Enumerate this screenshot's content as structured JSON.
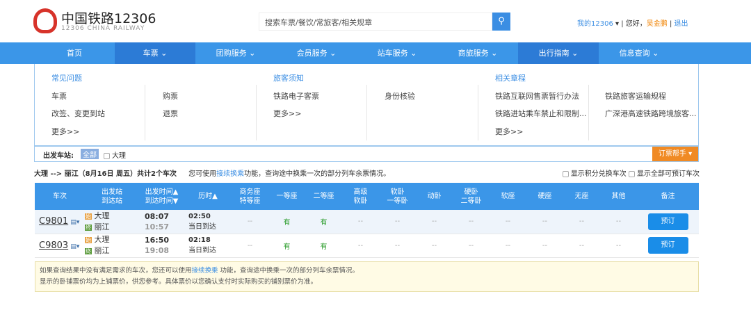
{
  "header": {
    "logo_cn": "中国铁路12306",
    "logo_en": "12306 CHINA RAILWAY",
    "search_placeholder": "搜索车票/餐饮/常旅客/相关规章",
    "my12306": "我的12306",
    "greeting": "您好，",
    "user": "吴金鹏",
    "logout": "退出"
  },
  "nav": [
    "首页",
    "车票",
    "团购服务",
    "会员服务",
    "站车服务",
    "商旅服务",
    "出行指南",
    "信息查询"
  ],
  "panel": {
    "col1": {
      "title": "常见问题",
      "items": [
        "车票",
        "购票",
        "改签、变更到站",
        "退票",
        "更多>>"
      ]
    },
    "col2": {
      "title": "旅客须知",
      "items": [
        "铁路电子客票",
        "身份核验",
        "更多>>"
      ]
    },
    "col3": {
      "title": "相关章程",
      "items": [
        "铁路互联网售票暂行办法",
        "铁路旅客运输规程",
        "铁路进站乘车禁止和限制...",
        "广深港高速铁路跨境旅客...",
        "更多>>"
      ]
    }
  },
  "filter": {
    "label": "出发车站:",
    "all": "全部",
    "station": "大理",
    "helper": "订票帮手 ▾"
  },
  "summary": {
    "route": "大理 --> 丽江（8月16日 周五）共计2个车次",
    "tip_pre": "您可使用",
    "tip_link": "接续换乘",
    "tip_post": "功能，查询途中换乘一次的部分列车余票情况。",
    "opt1": "显示积分兑换车次",
    "opt2": "显示全部可预订车次"
  },
  "columns": [
    "车次",
    "出发站\n到达站",
    "出发时间▲\n到达时间▼",
    "历时▲",
    "商务座\n特等座",
    "一等座",
    "二等座",
    "高级\n软卧",
    "软卧\n一等卧",
    "动卧",
    "硬卧\n二等卧",
    "软座",
    "硬座",
    "无座",
    "其他",
    "备注"
  ],
  "trains": [
    {
      "no": "C9801",
      "from": "大理",
      "to": "丽江",
      "dep": "08:07",
      "arr": "10:57",
      "dur": "02:50",
      "day": "当日到达",
      "seats": [
        "--",
        "有",
        "有",
        "--",
        "--",
        "--",
        "--",
        "--",
        "--",
        "--",
        "--"
      ],
      "book": "预订"
    },
    {
      "no": "C9803",
      "from": "大理",
      "to": "丽江",
      "dep": "16:50",
      "arr": "19:08",
      "dur": "02:18",
      "day": "当日到达",
      "seats": [
        "--",
        "有",
        "有",
        "--",
        "--",
        "--",
        "--",
        "--",
        "--",
        "--",
        "--"
      ],
      "book": "预订"
    }
  ],
  "notice": {
    "l1_pre": "如果查询结果中没有满足需求的车次，您还可以使用",
    "l1_link": "接续换乘",
    "l1_post": " 功能，查询途中换乘一次的部分列车余票情况。",
    "l2": "显示的卧铺票价均为上铺票价，供您参考。具体票价以您确认支付时实际购买的铺别票价为准。"
  }
}
